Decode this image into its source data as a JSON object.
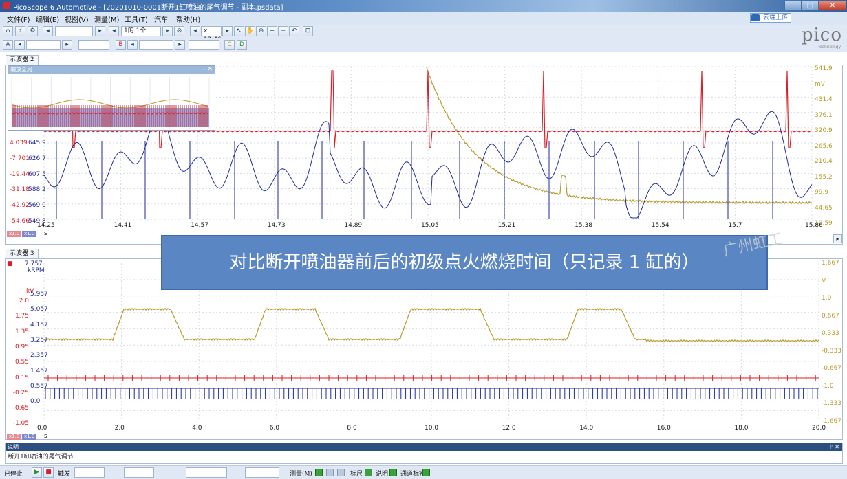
{
  "window": {
    "title": "PicoScope 6 Automotive - [20201010-0001断开1缸喷油的尾气调节 - 副本.psdata]",
    "min": "─",
    "max": "□",
    "close": "✕"
  },
  "menu": {
    "items": [
      "文件(F)",
      "编辑(E)",
      "视图(V)",
      "测量(M)",
      "工具(T)",
      "汽车",
      "帮助(H)"
    ],
    "upload": "云端上传"
  },
  "toolbar": {
    "buffer": "1的 1个",
    "zoom": "x 12.46",
    "channel_a": "A",
    "channel_b": "B",
    "channel_c": "C",
    "channel_d": "D"
  },
  "logo": {
    "text": "pico",
    "sub": "Technology"
  },
  "scope1": {
    "tab": "示波器 2",
    "overview_title": "缩放全局",
    "overview_controls": "- ✕",
    "left_axis_a": [
      "4.039",
      "-7.701",
      "-19.44",
      "-31.18",
      "-42.92",
      "-54.66"
    ],
    "left_axis_b": [
      "645.9",
      "626.7",
      "607.5",
      "588.2",
      "569.0",
      "549.8"
    ],
    "right_axis": [
      "541.9",
      "mV",
      "431.4",
      "376.1",
      "320.9",
      "265.6",
      "210.4",
      "155.2",
      "99.9",
      "44.65",
      "10.59"
    ],
    "x_ticks": [
      "14.25",
      "14.41",
      "14.57",
      "14.73",
      "14.89",
      "15.05",
      "15.21",
      "15.38",
      "15.54",
      "15.7",
      "15.86"
    ],
    "x_unit": "s",
    "chips": [
      "x1.0",
      "x1.0"
    ],
    "colors": {
      "blue": "#1f2a9e",
      "red": "#d9202a",
      "gold": "#b89a2a"
    }
  },
  "scope2": {
    "tab": "示波器 3",
    "top_left": {
      "a": "7.757",
      "b": "kRPM"
    },
    "kv_label": "kV",
    "left_axis_kv": [
      "2.0",
      "1.75",
      "1.35",
      "0.95",
      "0.55",
      "0.15",
      "-0.25",
      "-0.65",
      "-1.05"
    ],
    "left_axis_b": [
      "5.957",
      "5.057",
      "4.157",
      "3.257",
      "2.357",
      "1.457",
      "0.557",
      "0.0"
    ],
    "right_axis": [
      "1.667",
      "V",
      "1.0",
      "0.667",
      "0.333",
      "-0.333",
      "-0.667",
      "-1.0",
      "-1.333",
      "-1.667"
    ],
    "x_ticks": [
      "0.0",
      "2.0",
      "4.0",
      "6.0",
      "8.0",
      "10.0",
      "12.0",
      "14.0",
      "16.0",
      "18.0",
      "20.0"
    ],
    "x_unit": "s",
    "chips": [
      "x1.0",
      "x1.0"
    ]
  },
  "callout": "对比断开喷油器前后的初级点火燃烧时间（只记录 1 缸的）",
  "watermark": "广州虹工",
  "notes": {
    "title": "说明",
    "pin": "ᚹ ✕",
    "text": "断开1缸喷油的尾气调节"
  },
  "statusbar": {
    "stopped": "已停止",
    "trigger": "触发",
    "measure": "测量(M)",
    "ruler": "标尺",
    "note": "说明",
    "channel_label": "通道标签"
  }
}
